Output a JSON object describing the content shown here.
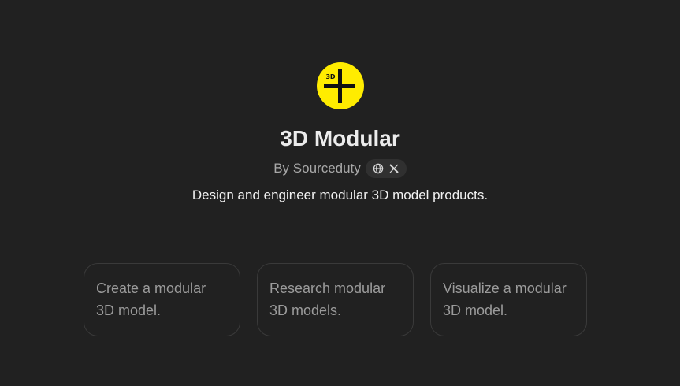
{
  "gpt": {
    "logo_text": "3D",
    "title": "3D Modular",
    "author": "By Sourceduty",
    "links": [
      {
        "icon": "globe-icon"
      },
      {
        "icon": "x-logo-icon"
      }
    ],
    "description": "Design and engineer modular 3D model products."
  },
  "conversation_starters": [
    {
      "label": "Create a modular 3D model."
    },
    {
      "label": "Research modular 3D models."
    },
    {
      "label": "Visualize a modular 3D model."
    }
  ],
  "colors": {
    "background": "#212121",
    "logo_yellow": "#ffec00",
    "pill_bg": "#303030",
    "card_border": "#3a3a3a"
  }
}
